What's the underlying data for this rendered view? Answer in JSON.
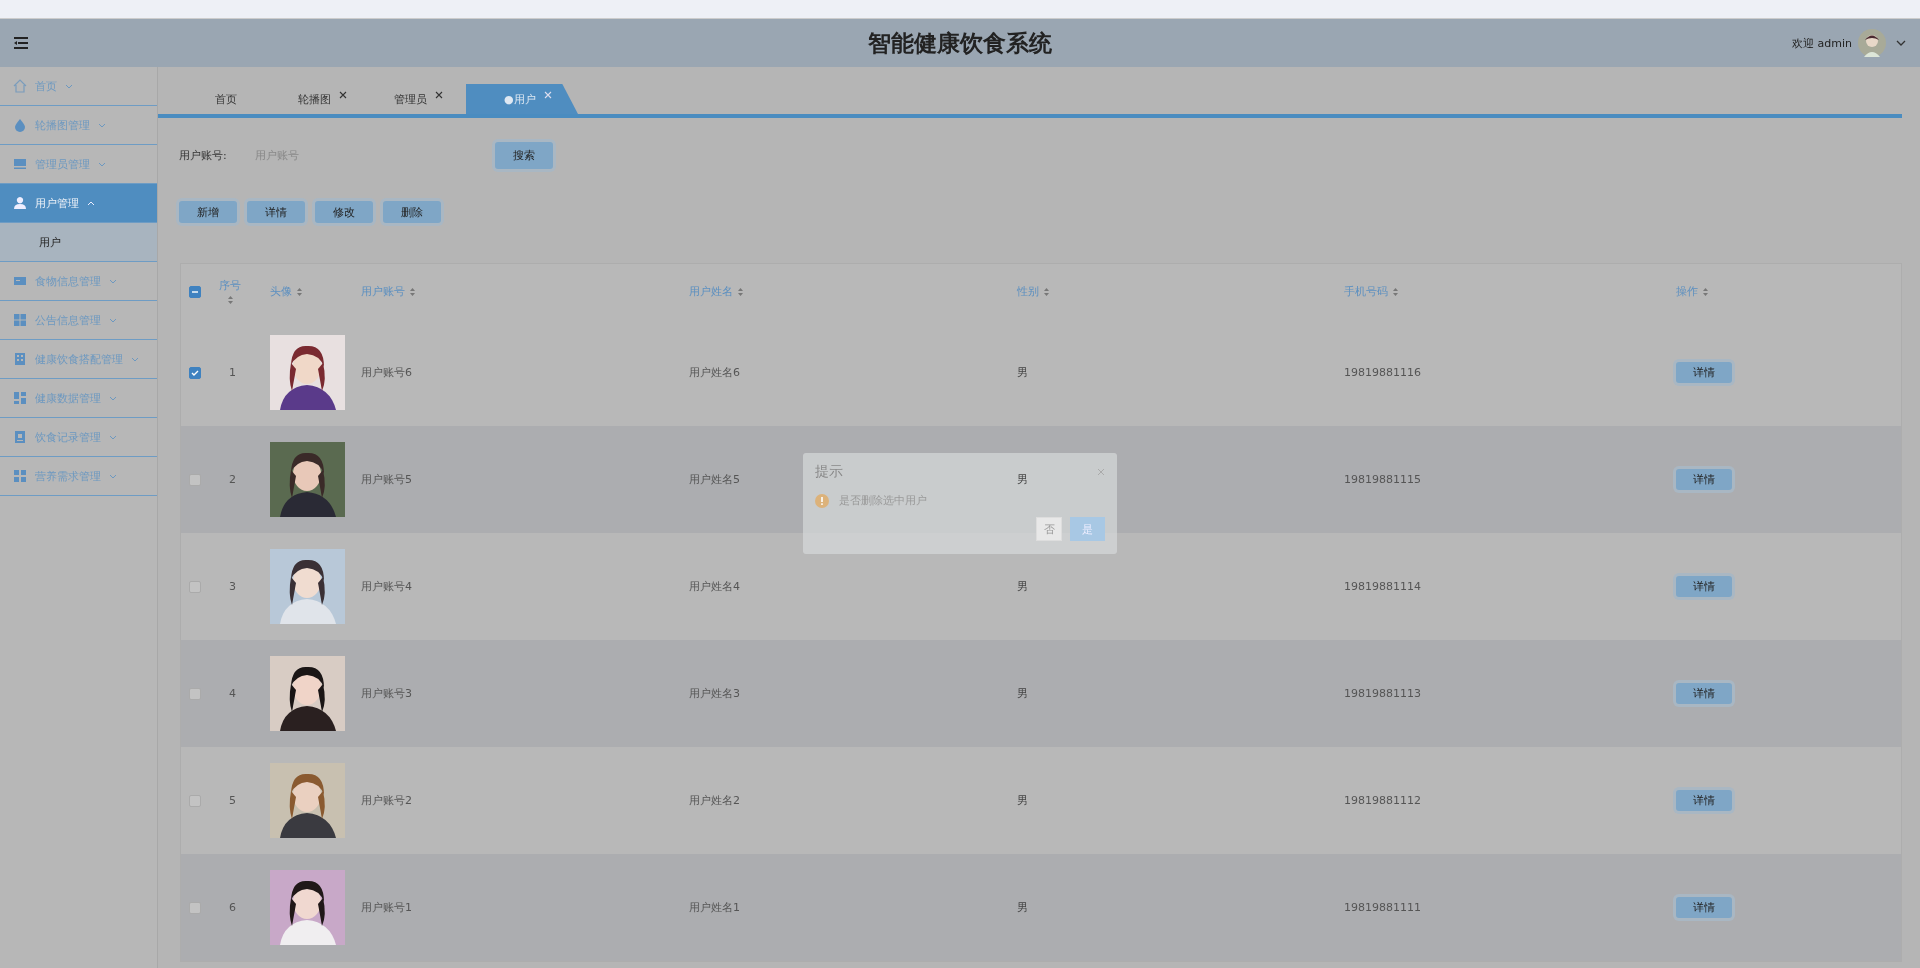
{
  "header": {
    "title": "智能健康饮食系统",
    "welcome": "欢迎 admin"
  },
  "sidebar": {
    "items": [
      {
        "label": "首页",
        "expanded": false,
        "selected": false
      },
      {
        "label": "轮播图管理",
        "expanded": false,
        "selected": false
      },
      {
        "label": "管理员管理",
        "expanded": false,
        "selected": false
      },
      {
        "label": "用户管理",
        "expanded": true,
        "selected": true,
        "children": [
          {
            "label": "用户"
          }
        ]
      },
      {
        "label": "食物信息管理",
        "expanded": false,
        "selected": false
      },
      {
        "label": "公告信息管理",
        "expanded": false,
        "selected": false
      },
      {
        "label": "健康饮食搭配管理",
        "expanded": false,
        "selected": false
      },
      {
        "label": "健康数据管理",
        "expanded": false,
        "selected": false
      },
      {
        "label": "饮食记录管理",
        "expanded": false,
        "selected": false
      },
      {
        "label": "营养需求管理",
        "expanded": false,
        "selected": false
      }
    ]
  },
  "tabs": [
    {
      "label": "首页",
      "closable": false,
      "selected": false
    },
    {
      "label": "轮播图",
      "closable": true,
      "selected": false
    },
    {
      "label": "管理员",
      "closable": true,
      "selected": false
    },
    {
      "label": "●用户",
      "closable": true,
      "selected": true
    }
  ],
  "search": {
    "label": "用户账号:",
    "placeholder": "用户账号",
    "button": "搜索"
  },
  "actions": [
    "新增",
    "详情",
    "修改",
    "删除"
  ],
  "table": {
    "header_checkbox": {
      "indeterminate": true
    },
    "columns": [
      {
        "label": "序号"
      },
      {
        "label": "头像"
      },
      {
        "label": "用户账号"
      },
      {
        "label": "用户姓名"
      },
      {
        "label": "性别"
      },
      {
        "label": "手机号码"
      },
      {
        "label": "操作"
      }
    ],
    "rows": [
      {
        "checked": true,
        "index": "1",
        "account": "用户账号6",
        "name": "用户姓名6",
        "gender": "男",
        "phone": "19819881116",
        "action": "详情"
      },
      {
        "checked": false,
        "index": "2",
        "account": "用户账号5",
        "name": "用户姓名5",
        "gender": "男",
        "phone": "19819881115",
        "action": "详情"
      },
      {
        "checked": false,
        "index": "3",
        "account": "用户账号4",
        "name": "用户姓名4",
        "gender": "男",
        "phone": "19819881114",
        "action": "详情"
      },
      {
        "checked": false,
        "index": "4",
        "account": "用户账号3",
        "name": "用户姓名3",
        "gender": "男",
        "phone": "19819881113",
        "action": "详情"
      },
      {
        "checked": false,
        "index": "5",
        "account": "用户账号2",
        "name": "用户姓名2",
        "gender": "男",
        "phone": "19819881112",
        "action": "详情"
      },
      {
        "checked": false,
        "index": "6",
        "account": "用户账号1",
        "name": "用户姓名1",
        "gender": "男",
        "phone": "19819881111",
        "action": "详情"
      }
    ]
  },
  "dialog": {
    "title": "提示",
    "message": "是否删除选中用户",
    "buttons": [
      {
        "label": "否",
        "primary": false
      },
      {
        "label": "是",
        "primary": true
      }
    ]
  }
}
